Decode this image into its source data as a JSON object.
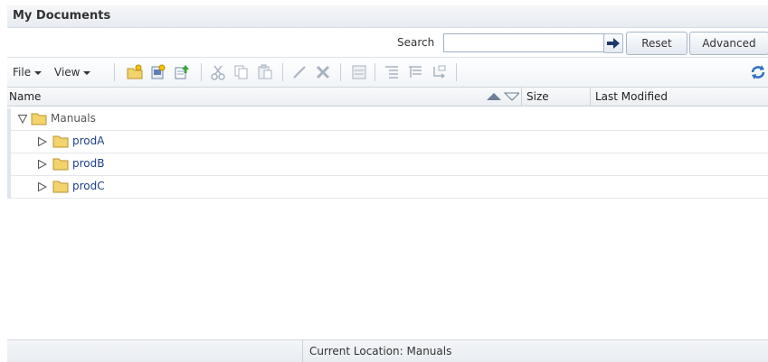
{
  "window": {
    "title": "My Documents"
  },
  "search": {
    "label": "Search",
    "value": "",
    "placeholder": "",
    "reset_label": "Reset",
    "advanced_label": "Advanced"
  },
  "toolbar": {
    "menus": [
      "File",
      "View"
    ],
    "icons": [
      "new-folder-icon",
      "new-document-icon",
      "upload-icon",
      "cut-icon",
      "copy-icon",
      "paste-icon",
      "edit-icon",
      "delete-icon",
      "properties-icon",
      "expand-all-icon",
      "collapse-all-icon",
      "move-icon",
      "refresh-icon"
    ]
  },
  "table": {
    "columns": [
      "Name",
      "Size",
      "Last Modified"
    ],
    "rows": [
      {
        "name": "Manuals",
        "level": 0,
        "expanded": true
      },
      {
        "name": "prodA",
        "level": 1,
        "expanded": false
      },
      {
        "name": "prodB",
        "level": 1,
        "expanded": false
      },
      {
        "name": "prodC",
        "level": 1,
        "expanded": false
      }
    ]
  },
  "status": {
    "location": "Current Location: Manuals"
  },
  "colors": {
    "accent": "#1d3f8a",
    "folder": "#f3d36b",
    "header_bg": "#eceff3"
  }
}
